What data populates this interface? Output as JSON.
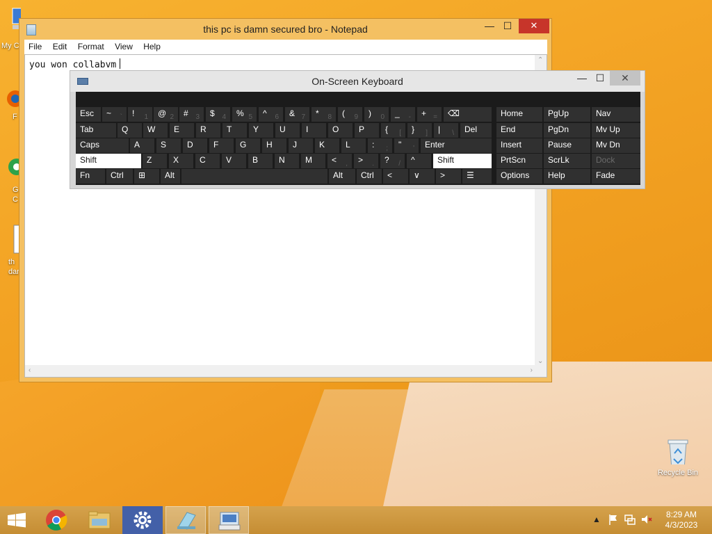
{
  "desktop": {
    "icons": [
      {
        "label": "My C"
      },
      {
        "label": "F"
      },
      {
        "label": "G\nC"
      },
      {
        "label": "th\ndan"
      }
    ],
    "recycle_bin": {
      "label": "Recycle Bin"
    }
  },
  "notepad": {
    "title": "this pc is damn secured bro - Notepad",
    "menu": [
      "File",
      "Edit",
      "Format",
      "View",
      "Help"
    ],
    "content": "you won collabvm",
    "controls": {
      "minimize": "—",
      "maximize": "☐",
      "close": "✕"
    }
  },
  "osk": {
    "title": "On-Screen Keyboard",
    "controls": {
      "minimize": "—",
      "maximize": "☐",
      "close": "✕"
    },
    "rows": [
      [
        {
          "label": "Esc"
        },
        {
          "label": "~",
          "sub": "`"
        },
        {
          "label": "!",
          "sub": "1"
        },
        {
          "label": "@",
          "sub": "2"
        },
        {
          "label": "#",
          "sub": "3"
        },
        {
          "label": "$",
          "sub": "4"
        },
        {
          "label": "%",
          "sub": "5"
        },
        {
          "label": "^",
          "sub": "6"
        },
        {
          "label": "&",
          "sub": "7"
        },
        {
          "label": "*",
          "sub": "8"
        },
        {
          "label": "(",
          "sub": "9"
        },
        {
          "label": ")",
          "sub": "0"
        },
        {
          "label": "_",
          "sub": "-"
        },
        {
          "label": "+",
          "sub": "="
        },
        {
          "label": "⌫"
        }
      ],
      [
        {
          "label": "Tab"
        },
        {
          "label": "Q"
        },
        {
          "label": "W"
        },
        {
          "label": "E"
        },
        {
          "label": "R"
        },
        {
          "label": "T"
        },
        {
          "label": "Y"
        },
        {
          "label": "U"
        },
        {
          "label": "I"
        },
        {
          "label": "O"
        },
        {
          "label": "P"
        },
        {
          "label": "{",
          "sub": "["
        },
        {
          "label": "}",
          "sub": "]"
        },
        {
          "label": "|",
          "sub": "\\"
        },
        {
          "label": "Del"
        }
      ],
      [
        {
          "label": "Caps"
        },
        {
          "label": "A"
        },
        {
          "label": "S"
        },
        {
          "label": "D"
        },
        {
          "label": "F"
        },
        {
          "label": "G"
        },
        {
          "label": "H"
        },
        {
          "label": "J"
        },
        {
          "label": "K"
        },
        {
          "label": "L"
        },
        {
          "label": ":",
          "sub": ";"
        },
        {
          "label": "\"",
          "sub": "'"
        },
        {
          "label": "Enter"
        }
      ],
      [
        {
          "label": "Shift"
        },
        {
          "label": "Z"
        },
        {
          "label": "X"
        },
        {
          "label": "C"
        },
        {
          "label": "V"
        },
        {
          "label": "B"
        },
        {
          "label": "N"
        },
        {
          "label": "M"
        },
        {
          "label": "<",
          "sub": ","
        },
        {
          "label": ">",
          "sub": "."
        },
        {
          "label": "?",
          "sub": "/"
        },
        {
          "label": "^"
        },
        {
          "label": "Shift"
        }
      ],
      [
        {
          "label": "Fn"
        },
        {
          "label": "Ctrl"
        },
        {
          "label": "⊞"
        },
        {
          "label": "Alt"
        },
        {
          "label": ""
        },
        {
          "label": "Alt"
        },
        {
          "label": "Ctrl"
        },
        {
          "label": "<"
        },
        {
          "label": "∨"
        },
        {
          "label": ">"
        },
        {
          "label": "☰"
        }
      ]
    ],
    "nav_keys": [
      [
        "Home",
        "PgUp",
        "Nav"
      ],
      [
        "End",
        "PgDn",
        "Mv Up"
      ],
      [
        "Insert",
        "Pause",
        "Mv Dn"
      ],
      [
        "PrtScn",
        "ScrLk",
        "Dock"
      ],
      [
        "Options",
        "Help",
        "Fade"
      ]
    ]
  },
  "taskbar": {
    "apps": [
      "start-button",
      "chrome",
      "file-explorer",
      "control-panel",
      "notepad",
      "on-screen-keyboard"
    ],
    "clock_time": "8:29 AM",
    "clock_date": "4/3/2023"
  }
}
